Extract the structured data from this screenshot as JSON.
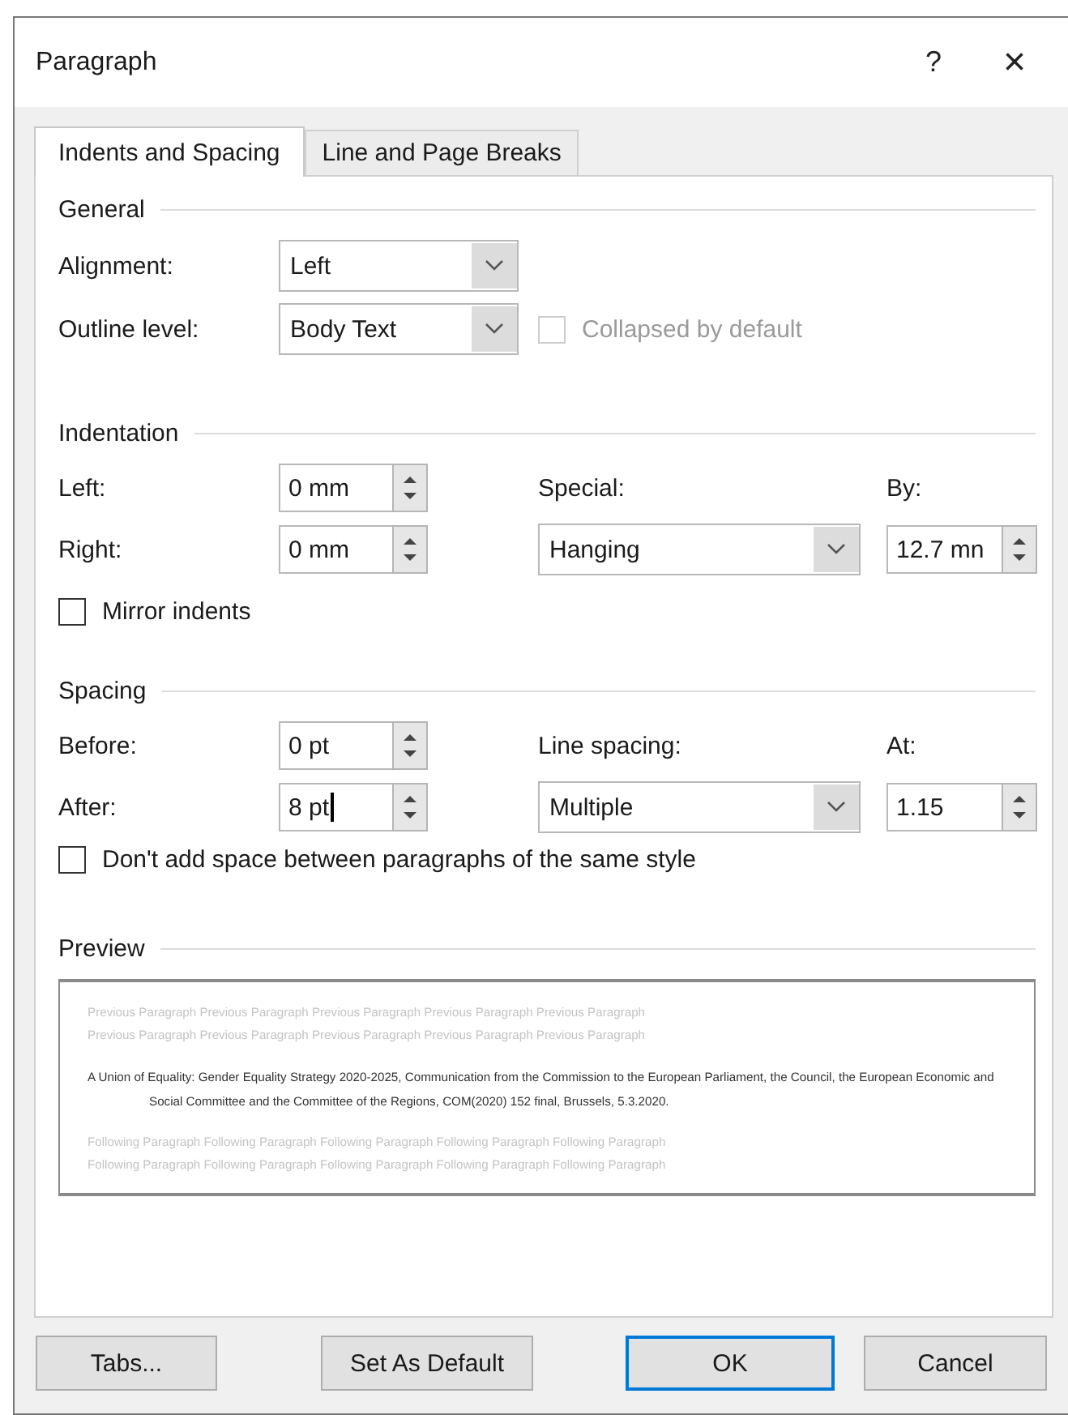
{
  "window": {
    "title": "Paragraph",
    "help": "?",
    "close": "×"
  },
  "tabs": [
    {
      "label": "Indents and Spacing",
      "selected": true
    },
    {
      "label": "Line and Page Breaks",
      "selected": false
    }
  ],
  "general": {
    "heading": "General",
    "alignment": {
      "label": "Alignment:",
      "value": "Left"
    },
    "outline_level": {
      "label": "Outline level:",
      "value": "Body Text"
    },
    "collapsed": {
      "label": "Collapsed by default",
      "checked": false,
      "disabled": true
    }
  },
  "indentation": {
    "heading": "Indentation",
    "left": {
      "label": "Left:",
      "value": "0 mm",
      "focused": false
    },
    "right": {
      "label": "Right:",
      "value": "0 mm",
      "focused": false
    },
    "special": {
      "label": "Special:",
      "value": "Hanging"
    },
    "by": {
      "label": "By:",
      "value": "12.7 mn",
      "focused": false
    },
    "mirror": {
      "label": "Mirror indents",
      "checked": false
    }
  },
  "spacing": {
    "heading": "Spacing",
    "before": {
      "label": "Before:",
      "value": "0 pt",
      "focused": false
    },
    "after": {
      "label": "After:",
      "value": "8 pt",
      "focused": true
    },
    "line_spacing": {
      "label": "Line spacing:",
      "value": "Multiple"
    },
    "at": {
      "label": "At:",
      "value": "1.15",
      "focused": false
    },
    "dont_add": {
      "label": "Don't add space between paragraphs of the same style",
      "checked": false
    }
  },
  "preview": {
    "heading": "Preview",
    "previous": [
      "Previous Paragraph Previous Paragraph Previous Paragraph Previous Paragraph Previous Paragraph",
      "Previous Paragraph Previous Paragraph Previous Paragraph Previous Paragraph Previous Paragraph"
    ],
    "paragraph": "A Union of Equality: Gender Equality Strategy 2020-2025, Communication from the Commission to the European Parliament, the Council, the European Economic and Social Committee and the Committee of the Regions, COM(2020) 152 final, Brussels, 5.3.2020.",
    "following": [
      "Following Paragraph Following Paragraph Following Paragraph Following Paragraph Following Paragraph",
      "Following Paragraph Following Paragraph Following Paragraph Following Paragraph Following Paragraph"
    ]
  },
  "buttons": [
    {
      "label": "Tabs...",
      "default": false
    },
    {
      "label": "Set As Default",
      "default": false
    },
    {
      "label": "OK",
      "default": true
    },
    {
      "label": "Cancel",
      "default": false
    }
  ]
}
